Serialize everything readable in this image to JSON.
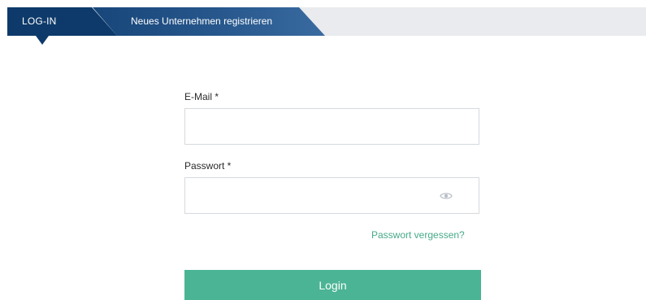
{
  "tabs": {
    "login": {
      "label": "LOG-IN"
    },
    "register": {
      "label": "Neues Unternehmen registrieren"
    }
  },
  "form": {
    "email": {
      "label": "E-Mail *",
      "value": "",
      "placeholder": ""
    },
    "password": {
      "label": "Passwort *",
      "value": "",
      "placeholder": "",
      "toggle_icon": "eye-icon"
    },
    "forgot_password_label": "Passwort vergessen?",
    "submit_label": "Login"
  },
  "colors": {
    "active_tab": "#0d3a6a",
    "inactive_tab": "#27578c",
    "tab_bar_background": "#e9ebee",
    "accent": "#4bb494",
    "link": "#46a98a"
  }
}
